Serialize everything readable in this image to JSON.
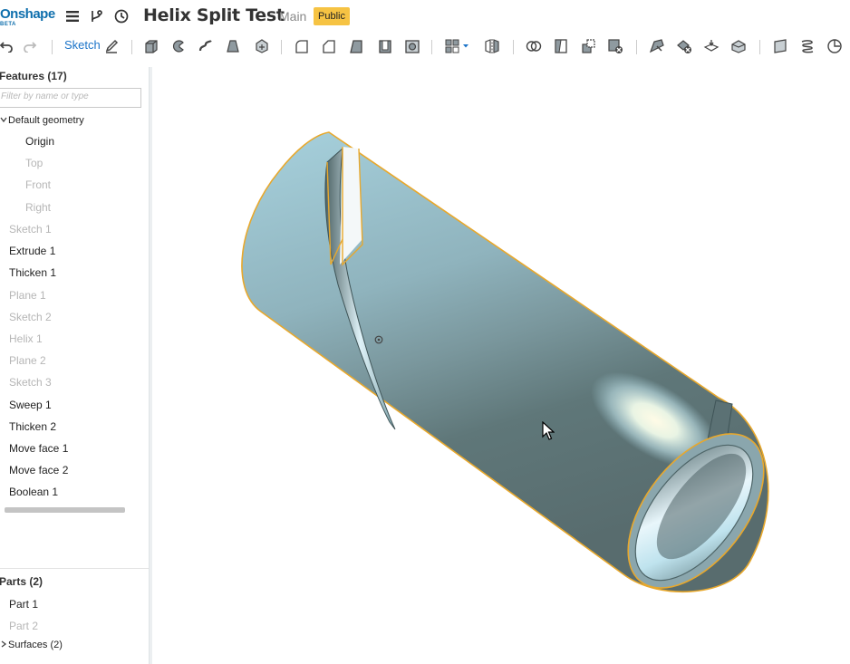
{
  "app": {
    "logo": "Onshape",
    "logo_tag": "BETA",
    "doc_title": "Helix Split Test",
    "branch": "Main",
    "visibility_badge": "Public"
  },
  "header_icons": [
    "menu-icon",
    "branch-icon",
    "history-icon"
  ],
  "toolbar": {
    "sketch_label": "Sketch",
    "tools": [
      "undo",
      "redo",
      "sketch-pencil",
      "extrude",
      "revolve",
      "sweep",
      "loft",
      "thicken",
      "fillet",
      "chamfer",
      "draft",
      "shell",
      "hole",
      "pattern",
      "mirror",
      "boolean",
      "split",
      "transform",
      "delete-part",
      "move-face",
      "delete-face",
      "offset-surface",
      "replace-face",
      "plane",
      "helix",
      "mate-connector"
    ]
  },
  "features": {
    "header": "Features (17)",
    "filter_placeholder": "Filter by name or type",
    "default_geometry": "Default geometry",
    "default_items": [
      {
        "label": "Origin",
        "dim": false
      },
      {
        "label": "Top",
        "dim": true
      },
      {
        "label": "Front",
        "dim": true
      },
      {
        "label": "Right",
        "dim": true
      }
    ],
    "items": [
      {
        "label": "Sketch 1",
        "dim": true
      },
      {
        "label": "Extrude 1",
        "dim": false
      },
      {
        "label": "Thicken 1",
        "dim": false
      },
      {
        "label": "Plane 1",
        "dim": true
      },
      {
        "label": "Sketch 2",
        "dim": true
      },
      {
        "label": "Helix 1",
        "dim": true
      },
      {
        "label": "Plane 2",
        "dim": true
      },
      {
        "label": "Sketch 3",
        "dim": true
      },
      {
        "label": "Sweep 1",
        "dim": false
      },
      {
        "label": "Thicken 2",
        "dim": false
      },
      {
        "label": "Move face 1",
        "dim": false
      },
      {
        "label": "Move face 2",
        "dim": false
      },
      {
        "label": "Boolean 1",
        "dim": false
      }
    ]
  },
  "parts": {
    "header": "Parts (2)",
    "items": [
      {
        "label": "Part 1",
        "dim": false
      },
      {
        "label": "Part 2",
        "dim": true
      }
    ],
    "surfaces": "Surfaces (2)"
  },
  "colors": {
    "brand": "#0f6fad",
    "accent_link": "#1a73c8",
    "badge": "#f6c343",
    "model_edge": "#e8a82c",
    "model_light": "#9cc8d6",
    "model_dark": "#5a6e70"
  }
}
